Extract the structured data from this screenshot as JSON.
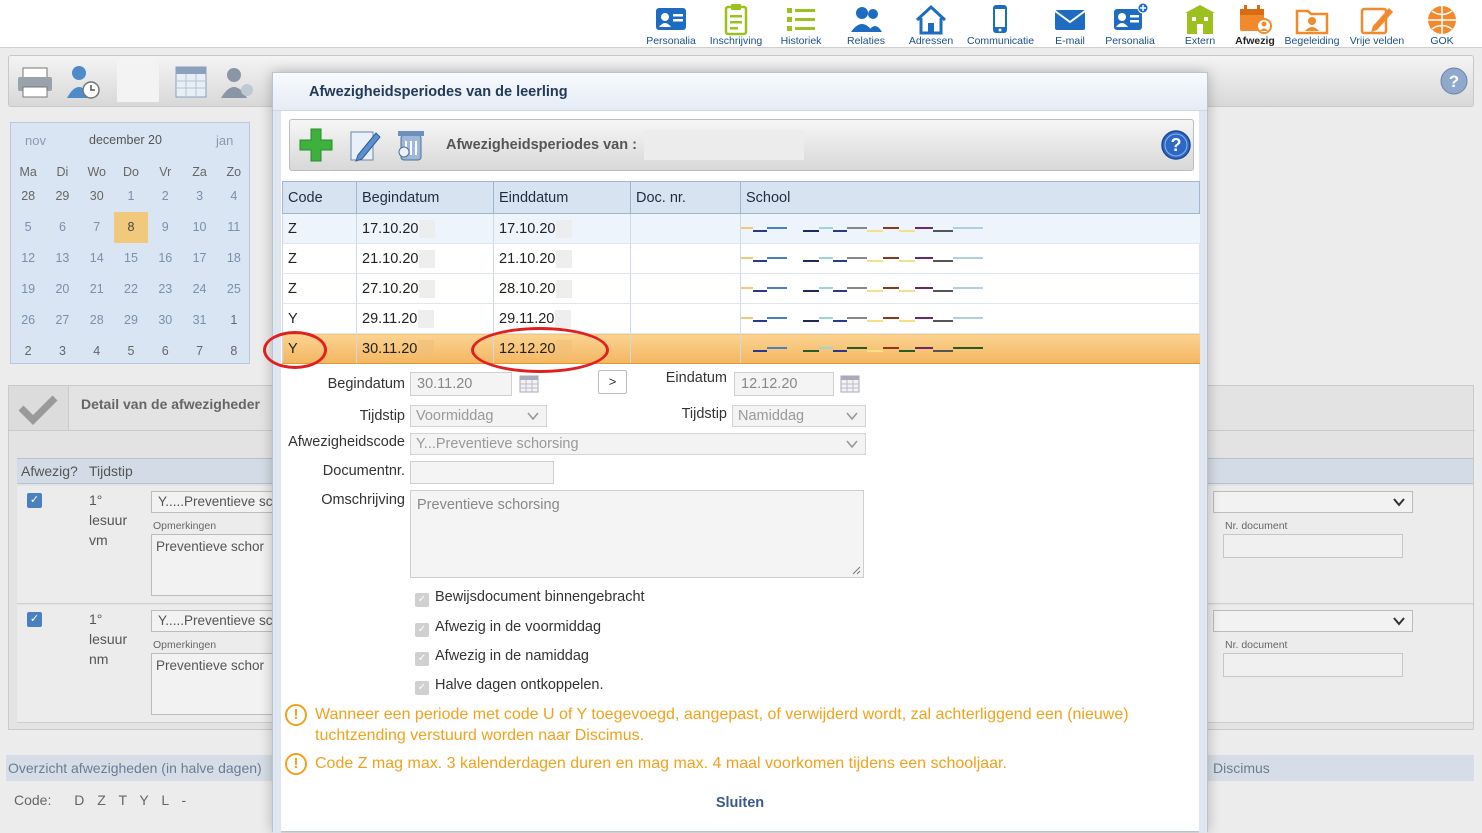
{
  "topnav": [
    {
      "label": "Personalia",
      "icon": "id-card-icon",
      "active": false
    },
    {
      "label": "Inschrijving",
      "icon": "clipboard-icon",
      "active": false
    },
    {
      "label": "Historiek",
      "icon": "list-icon",
      "active": false
    },
    {
      "label": "Relaties",
      "icon": "people-icon",
      "active": false
    },
    {
      "label": "Adressen",
      "icon": "house-icon",
      "active": false
    },
    {
      "label": "Communicatie",
      "icon": "phone-icon",
      "active": false
    },
    {
      "label": "E-mail",
      "icon": "envelope-icon",
      "active": false
    },
    {
      "label": "Personalia",
      "icon": "id-card-plus-icon",
      "active": false
    },
    {
      "label": "Extern",
      "icon": "building-icon",
      "active": false
    },
    {
      "label": "Afwezig",
      "icon": "calendar-person-icon",
      "active": true
    },
    {
      "label": "Begeleiding",
      "icon": "folder-person-icon",
      "active": false
    },
    {
      "label": "Vrije velden",
      "icon": "edit-icon",
      "active": false
    },
    {
      "label": "GOK",
      "icon": "globe-icon",
      "active": false
    }
  ],
  "calendar": {
    "prev": "nov",
    "month": "december 20",
    "next": "jan",
    "weekdays": [
      "Ma",
      "Di",
      "Wo",
      "Do",
      "Vr",
      "Za",
      "Zo"
    ],
    "weeks": [
      [
        "28",
        "29",
        "30",
        "1",
        "2",
        "3",
        "4"
      ],
      [
        "5",
        "6",
        "7",
        "8",
        "9",
        "10",
        "11"
      ],
      [
        "12",
        "13",
        "14",
        "15",
        "16",
        "17",
        "18"
      ],
      [
        "19",
        "20",
        "21",
        "22",
        "23",
        "24",
        "25"
      ],
      [
        "26",
        "27",
        "28",
        "29",
        "30",
        "31",
        "1"
      ],
      [
        "2",
        "3",
        "4",
        "5",
        "6",
        "7",
        "8"
      ]
    ],
    "today": "8"
  },
  "detail": {
    "title": "Detail van de afwezigheder",
    "col_afwezig": "Afwezig?",
    "col_tijdstip": "Tijdstip",
    "rows": [
      {
        "period": "1°",
        "unit": "lesuur",
        "part": "vm",
        "code": "Y.....Preventieve sch",
        "remarks_label": "Opmerkingen",
        "remarks": "Preventieve schor",
        "docnr_label": "Nr. document"
      },
      {
        "period": "1°",
        "unit": "lesuur",
        "part": "nm",
        "code": "Y.....Preventieve sch",
        "remarks_label": "Opmerkingen",
        "remarks": "Preventieve schor",
        "docnr_label": "Nr. document"
      }
    ]
  },
  "overview": {
    "label": "Overzicht afwezigheden (in halve dagen)",
    "right": "Discimus"
  },
  "code_legend": {
    "label": "Code:",
    "codes": "D Z T Y L -"
  },
  "modal": {
    "title": "Afwezigheidsperiodes van de leerling",
    "toolbar_label": "Afwezigheidsperiodes van :",
    "columns": [
      "Code",
      "Begindatum",
      "Einddatum",
      "Doc. nr.",
      "School"
    ],
    "rows": [
      {
        "code": "Z",
        "begin": "17.10.20",
        "end": "17.10.20",
        "doc": "",
        "selected": false
      },
      {
        "code": "Z",
        "begin": "21.10.20",
        "end": "21.10.20",
        "doc": "",
        "selected": false
      },
      {
        "code": "Z",
        "begin": "27.10.20",
        "end": "28.10.20",
        "doc": "",
        "selected": false
      },
      {
        "code": "Y",
        "begin": "29.11.20",
        "end": "29.11.20",
        "doc": "",
        "selected": false
      },
      {
        "code": "Y",
        "begin": "30.11.20",
        "end": "12.12.20",
        "doc": "",
        "selected": true
      }
    ],
    "form": {
      "begin_label": "Begindatum",
      "begin_value": "30.11.20",
      "arrow": ">",
      "end_label": "Eindatum",
      "end_value": "12.12.20",
      "time_label_left": "Tijdstip",
      "time_value_left": "Voormiddag",
      "time_label_right": "Tijdstip",
      "time_value_right": "Namiddag",
      "code_label": "Afwezigheidscode",
      "code_value": "Y...Preventieve schorsing",
      "docnr_label": "Documentnr.",
      "docnr_value": "",
      "desc_label": "Omschrijving",
      "desc_value": "Preventieve schorsing",
      "checks": [
        {
          "label": "Bewijsdocument binnengebracht",
          "checked": true
        },
        {
          "label": "Afwezig in de voormiddag",
          "checked": true
        },
        {
          "label": "Afwezig in de namiddag",
          "checked": true
        },
        {
          "label": "Halve dagen ontkoppelen.",
          "checked": true
        }
      ]
    },
    "warnings": [
      "Wanneer een periode met code U of Y toegevoegd, aangepast, of verwijderd wordt, zal achterliggend een (nieuwe) tuchtzending verstuurd worden naar Discimus.",
      "Code Z mag max. 3 kalenderdagen duren en mag max. 4 maal voorkomen tijdens een schooljaar."
    ],
    "close_label": "Sluiten"
  },
  "colors": {
    "accent": "#1b5aa0",
    "selected_row": "#f6c070",
    "warning": "#f0a21c",
    "highlight_circle": "#e02020"
  }
}
